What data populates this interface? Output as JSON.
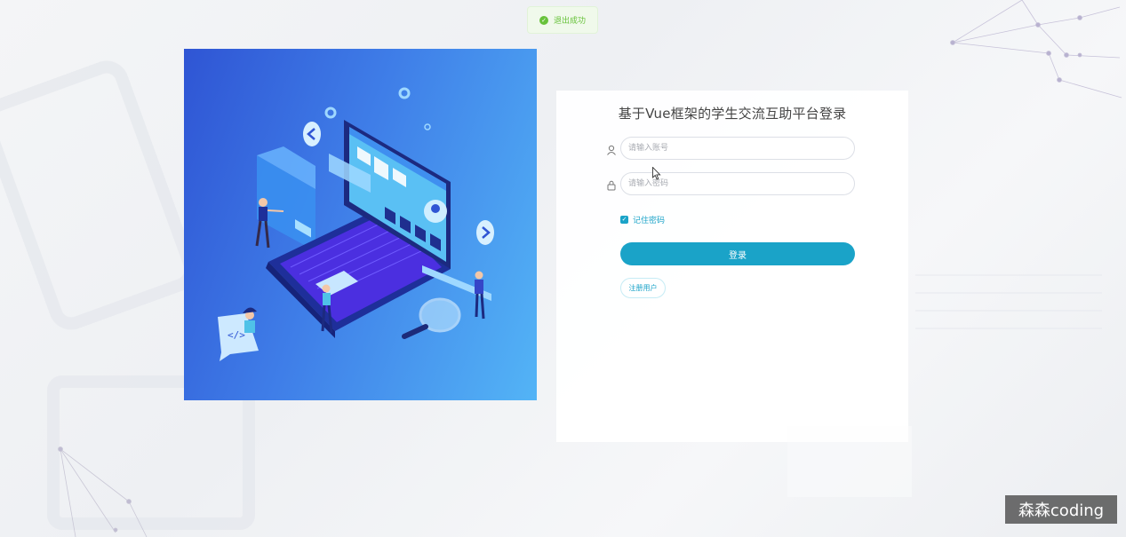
{
  "toast": {
    "message": "退出成功",
    "icon": "success-check-icon",
    "color": "#67c23a"
  },
  "login": {
    "title": "基于Vue框架的学生交流互助平台登录",
    "username": {
      "placeholder": "请输入账号",
      "value": "",
      "icon": "user-icon"
    },
    "password": {
      "placeholder": "请输入密码",
      "value": "",
      "icon": "lock-icon"
    },
    "remember_label": "记住密码",
    "remember_checked": true,
    "submit_label": "登录",
    "register_label": "注册用户",
    "accent_color": "#1aa3c8"
  },
  "hero": {
    "illustration": "isometric-laptop-illustration",
    "colors": [
      "#2f55d4",
      "#53b4f6"
    ]
  },
  "watermark": {
    "text": "森森coding"
  }
}
